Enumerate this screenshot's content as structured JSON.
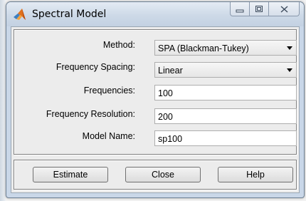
{
  "window": {
    "title": "Spectral Model"
  },
  "form": {
    "method": {
      "label": "Method:",
      "value": "SPA (Blackman-Tukey)"
    },
    "frequency_spacing": {
      "label": "Frequency Spacing:",
      "value": "Linear"
    },
    "frequencies": {
      "label": "Frequencies:",
      "value": "100"
    },
    "frequency_resolution": {
      "label": "Frequency Resolution:",
      "value": "200"
    },
    "model_name": {
      "label": "Model Name:",
      "value": "sp100"
    }
  },
  "buttons": {
    "estimate": "Estimate",
    "close": "Close",
    "help": "Help"
  },
  "icons": {
    "app": "matlab-logo-icon",
    "minimize": "minimize-icon",
    "maximize": "maximize-icon",
    "close": "close-icon"
  },
  "colors": {
    "titlebar": "#c9d7e8",
    "client": "#ececec"
  }
}
